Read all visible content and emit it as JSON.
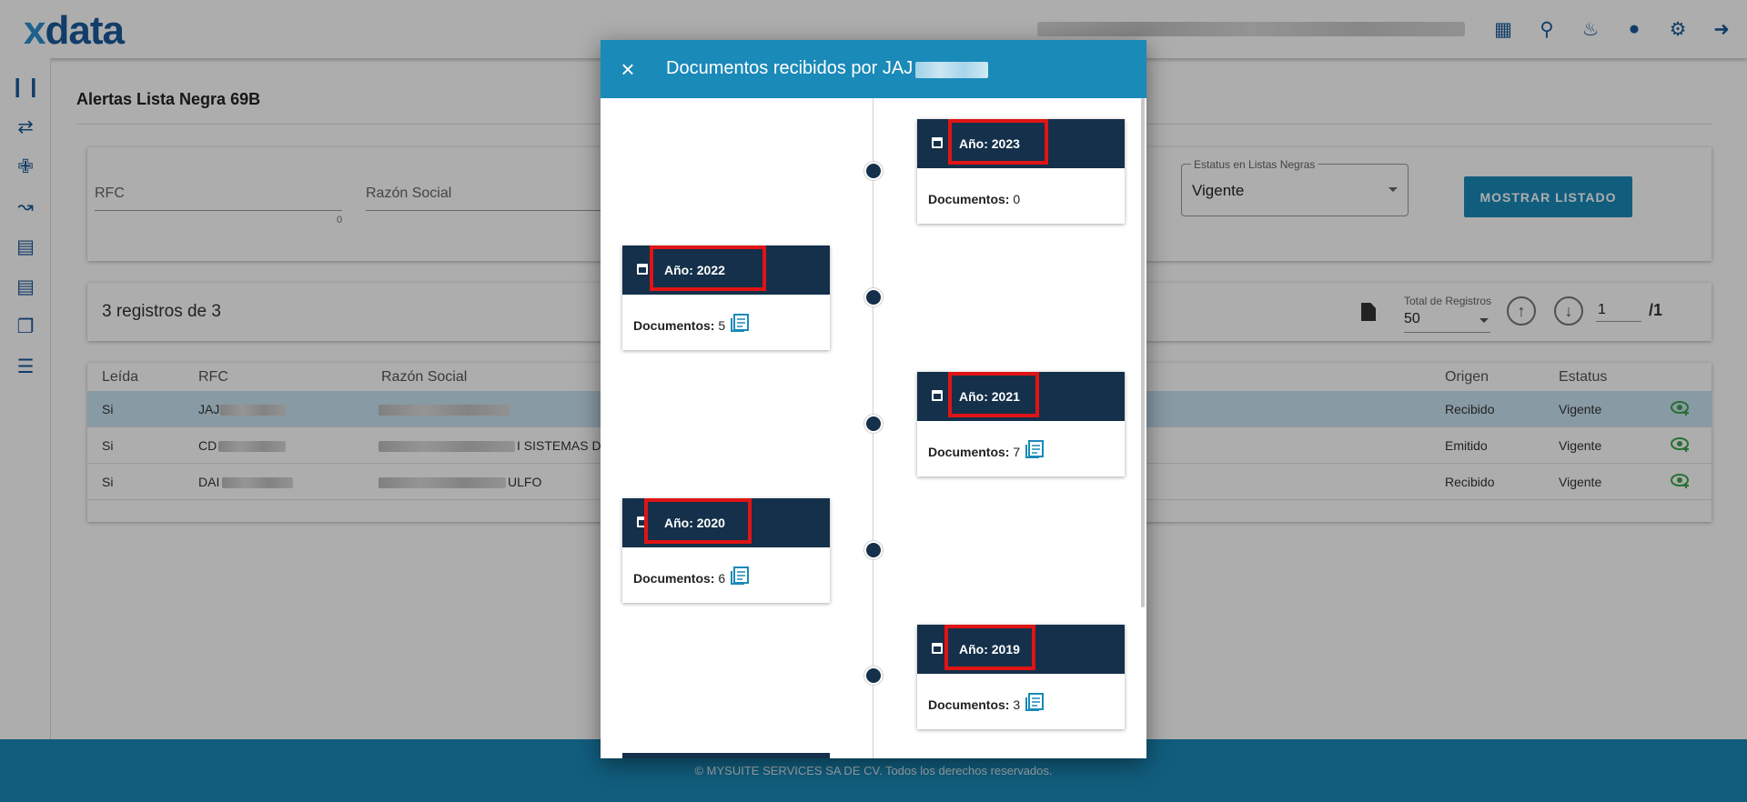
{
  "app": {
    "logo_x": "x",
    "logo_text": "data"
  },
  "topbar": {
    "icons": [
      "card-icon",
      "search-icon",
      "bell-icon",
      "user-icon",
      "gear-icon",
      "logout-icon"
    ]
  },
  "sidebar": {
    "icons": [
      "library-icon",
      "swap-icon",
      "person-icon",
      "chart-icon",
      "document-list-icon",
      "compare-icon",
      "copy-icon",
      "list-icon"
    ]
  },
  "page": {
    "title": "Alertas Lista Negra 69B"
  },
  "filters": {
    "rfc_label": "RFC",
    "rfc_counter": "0",
    "razon_label": "Razón Social",
    "estatus_label": "Estatus en Listas Negras",
    "estatus_value": "Vigente",
    "mostrar_button": "MOSTRAR LISTADO"
  },
  "summary": {
    "count_text": "3 registros de 3",
    "total_label": "Total de Registros",
    "total_value": "50",
    "page_value": "1",
    "page_total": "/1"
  },
  "table": {
    "headers": {
      "leida": "Leída",
      "rfc": "RFC",
      "razon": "Razón Social",
      "origen": "Origen",
      "estatus": "Estatus"
    },
    "rows": [
      {
        "leida": "Si",
        "rfc": "JAJ",
        "razon": "",
        "origen": "Recibido",
        "estatus": "Vigente"
      },
      {
        "leida": "Si",
        "rfc": "CD",
        "razon": "I SISTEMAS D",
        "origen": "Emitido",
        "estatus": "Vigente"
      },
      {
        "leida": "Si",
        "rfc": "DAI",
        "razon": "ULFO",
        "origen": "Recibido",
        "estatus": "Vigente"
      }
    ]
  },
  "footer": {
    "text": "© MYSUITE SERVICES SA DE CV. Todos los derechos reservados."
  },
  "modal": {
    "close_icon": "×",
    "title": "Documentos recibidos por JAJ",
    "docs_label": "Documentos:",
    "cards": [
      {
        "year": "Año: 2023",
        "docs": "0"
      },
      {
        "year": "Año: 2022",
        "docs": "5"
      },
      {
        "year": "Año: 2021",
        "docs": "7"
      },
      {
        "year": "Año: 2020",
        "docs": "6"
      },
      {
        "year": "Año: 2019",
        "docs": "3"
      }
    ]
  },
  "colors": {
    "accent": "#1a8ab8",
    "dark_navy": "#14304a",
    "highlight_red": "#e01414",
    "eye_green": "#3aa54a"
  }
}
